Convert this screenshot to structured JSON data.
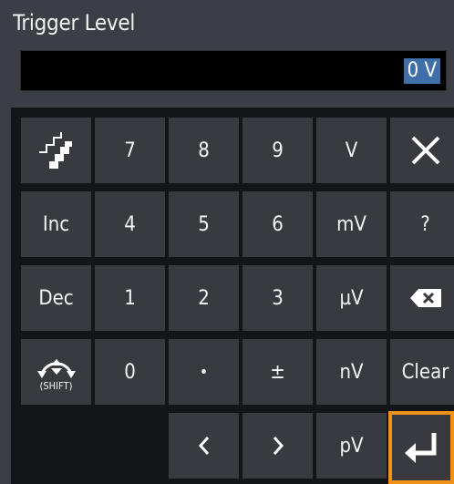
{
  "dialog": {
    "title": "Trigger Level",
    "value": "0 V"
  },
  "keys": {
    "k7": "7",
    "k8": "8",
    "k9": "9",
    "unit_v": "V",
    "inc": "Inc",
    "k4": "4",
    "k5": "5",
    "k6": "6",
    "unit_mv": "mV",
    "help": "?",
    "dec": "Dec",
    "k1": "1",
    "k2": "2",
    "k3": "3",
    "unit_uv": "µV",
    "shift_caption": "(SHIFT)",
    "k0": "0",
    "dot": "•",
    "plusminus": "±",
    "unit_nv": "nV",
    "clear": "Clear",
    "unit_pv": "pV"
  },
  "colors": {
    "accent_selection": "#f0921a",
    "value_highlight": "#3f6fa8"
  },
  "icons": {
    "step": "step-icon",
    "close": "close-icon",
    "backspace": "backspace-icon",
    "rotary": "rotary-knob-icon",
    "left": "chevron-left-icon",
    "right": "chevron-right-icon",
    "enter": "enter-icon"
  }
}
